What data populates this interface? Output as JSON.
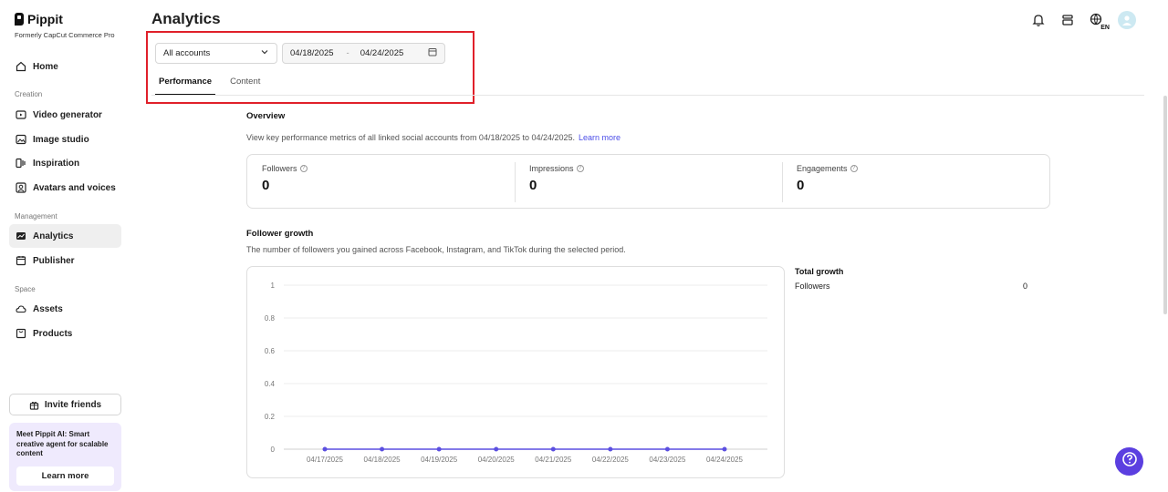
{
  "brand": {
    "name": "Pippit",
    "subtitle": "Formerly CapCut Commerce Pro"
  },
  "sidebar": {
    "home": "Home",
    "creation_label": "Creation",
    "video_generator": "Video generator",
    "image_studio": "Image studio",
    "inspiration": "Inspiration",
    "avatars_voices": "Avatars and voices",
    "management_label": "Management",
    "analytics": "Analytics",
    "publisher": "Publisher",
    "space_label": "Space",
    "assets": "Assets",
    "products": "Products",
    "invite_friends": "Invite friends",
    "promo_text": "Meet Pippit AI: Smart creative agent for scalable content",
    "promo_button": "Learn more"
  },
  "header": {
    "title": "Analytics",
    "language_badge": "EN"
  },
  "filters": {
    "account_select": "All accounts",
    "date_start": "04/18/2025",
    "date_separator": "-",
    "date_end": "04/24/2025"
  },
  "tabs": [
    "Performance",
    "Content"
  ],
  "overview": {
    "title": "Overview",
    "description": "View key performance metrics of all linked social accounts from 04/18/2025 to 04/24/2025.",
    "learn_more": "Learn more",
    "metrics": [
      {
        "label": "Followers",
        "value": "0"
      },
      {
        "label": "Impressions",
        "value": "0"
      },
      {
        "label": "Engagements",
        "value": "0"
      }
    ]
  },
  "follower_growth": {
    "title": "Follower growth",
    "description": "The number of followers you gained across Facebook, Instagram, and TikTok during the selected period."
  },
  "total_growth": {
    "title": "Total growth",
    "label": "Followers",
    "value": "0"
  },
  "chart_data": {
    "type": "line",
    "categories": [
      "04/17/2025",
      "04/18/2025",
      "04/19/2025",
      "04/20/2025",
      "04/21/2025",
      "04/22/2025",
      "04/23/2025",
      "04/24/2025"
    ],
    "series": [
      {
        "values": [
          0,
          0,
          0,
          0,
          0,
          0,
          0,
          0
        ]
      }
    ],
    "yticks": [
      "0",
      "0.2",
      "0.4",
      "0.6",
      "0.8",
      "1"
    ],
    "ylim": [
      0,
      1
    ],
    "grid": true,
    "color": "#5b4fe0"
  },
  "colors": {
    "accent": "#5b3fe0",
    "highlight": "#e0202a",
    "link": "#4b4de8"
  }
}
